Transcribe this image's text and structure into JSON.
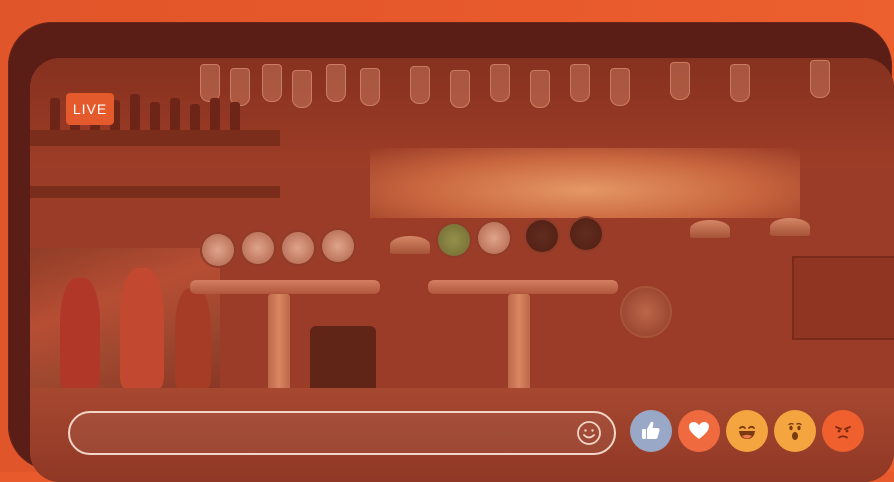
{
  "stream": {
    "live_label": "LIVE"
  },
  "comment_box": {
    "placeholder": ""
  },
  "icons": {
    "emoji": "smiley-face-icon",
    "like": "thumbs-up-icon",
    "love": "heart-icon",
    "haha": "laughing-face-icon",
    "wow": "surprised-face-icon",
    "angry": "angry-face-icon"
  },
  "colors": {
    "accent": "#e85a2c",
    "frame": "#5a1e16",
    "like": "#9aa8c8",
    "love": "#f06a40",
    "haha": "#f5a540",
    "wow": "#f5a540",
    "angry": "#f0602e"
  }
}
